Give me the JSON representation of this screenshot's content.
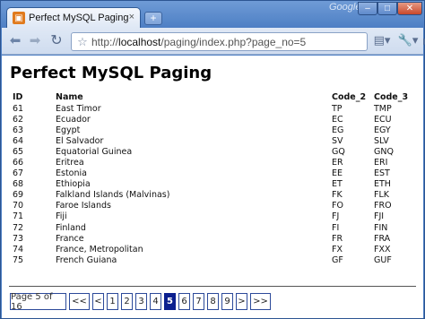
{
  "browser": {
    "brand": "Google",
    "tab_title": "Perfect MySQL Paging",
    "tab_close": "×",
    "newtab": "+",
    "url_prefix": "http://",
    "url_host": "localhost",
    "url_path": "/paging/index.php?page_no=5",
    "window_buttons": {
      "minimize": "–",
      "maximize": "□",
      "close": "✕"
    }
  },
  "page": {
    "heading": "Perfect MySQL Paging",
    "columns": [
      "ID",
      "Name",
      "Code_2",
      "Code_3"
    ],
    "rows": [
      [
        "61",
        "East Timor",
        "TP",
        "TMP"
      ],
      [
        "62",
        "Ecuador",
        "EC",
        "ECU"
      ],
      [
        "63",
        "Egypt",
        "EG",
        "EGY"
      ],
      [
        "64",
        "El Salvador",
        "SV",
        "SLV"
      ],
      [
        "65",
        "Equatorial Guinea",
        "GQ",
        "GNQ"
      ],
      [
        "66",
        "Eritrea",
        "ER",
        "ERI"
      ],
      [
        "67",
        "Estonia",
        "EE",
        "EST"
      ],
      [
        "68",
        "Ethiopia",
        "ET",
        "ETH"
      ],
      [
        "69",
        "Falkland Islands (Malvinas)",
        "FK",
        "FLK"
      ],
      [
        "70",
        "Faroe Islands",
        "FO",
        "FRO"
      ],
      [
        "71",
        "Fiji",
        "FJ",
        "FJI"
      ],
      [
        "72",
        "Finland",
        "FI",
        "FIN"
      ],
      [
        "73",
        "France",
        "FR",
        "FRA"
      ],
      [
        "74",
        "France, Metropolitan",
        "FX",
        "FXX"
      ],
      [
        "75",
        "French Guiana",
        "GF",
        "GUF"
      ]
    ]
  },
  "pagination": {
    "info": "Page 5 of 16",
    "first": "<<",
    "prev": "<",
    "pages": [
      "1",
      "2",
      "3",
      "4",
      "5",
      "6",
      "7",
      "8",
      "9"
    ],
    "current": "5",
    "next": ">",
    "last": ">>"
  },
  "colors": {
    "current_page_bg": "#0b1f8f",
    "frame": "#4d7fc4"
  }
}
